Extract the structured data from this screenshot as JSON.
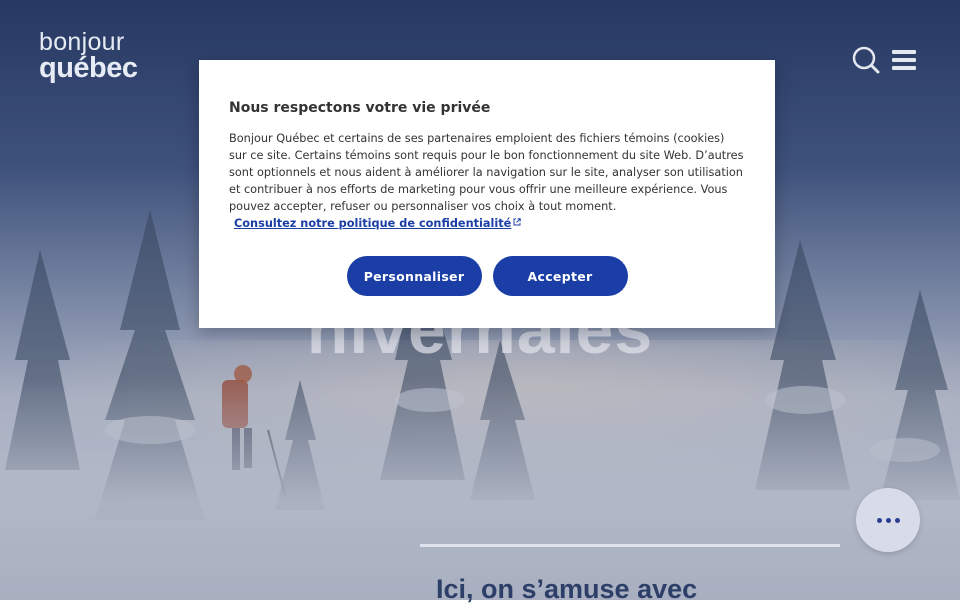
{
  "header": {
    "logo_line1": "bonjour",
    "logo_line2": "québec",
    "search_icon": "search-icon",
    "menu_icon": "hamburger-menu-icon"
  },
  "hero": {
    "headline": "hivernales",
    "subline": "Ici, on s’amuse avec"
  },
  "cookie_modal": {
    "title": "Nous respectons votre vie privée",
    "body": "Bonjour Québec et certains de ses partenaires emploient des fichiers témoins (cookies) sur ce site. Certains témoins sont requis pour le bon fonctionnement du site Web. D’autres sont optionnels et nous aident à améliorer la navigation sur le site, analyser son utilisation et contribuer à nos efforts de marketing pour vous offrir une meilleure expérience. Vous pouvez accepter, refuser ou personnaliser vos choix à tout moment.",
    "policy_link": "Consultez notre politique de confidentialité",
    "personalize_button": "Personnaliser",
    "accept_button": "Accepter"
  },
  "fab": {
    "icon": "more-horizontal-icon"
  },
  "colors": {
    "brand_blue": "#1a3ea6",
    "modal_background": "#ffffff"
  }
}
